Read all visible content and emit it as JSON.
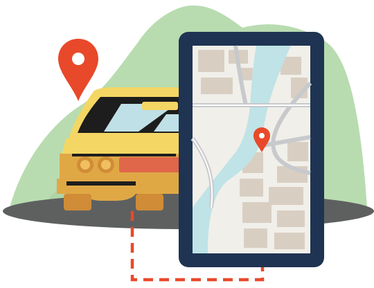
{
  "illustration": {
    "subject": "car-tracking-illustration",
    "icons": [
      "location-pin-icon",
      "car-icon",
      "tablet-icon",
      "map-icon",
      "route-line-icon"
    ],
    "colors": {
      "pin_red": "#e8492a",
      "route_red": "#e8492a",
      "car_yellow": "#f4d664",
      "car_orange": "#e0a845",
      "car_shadow_orange": "#d08c36",
      "tablet_frame": "#1f3452",
      "map_water": "#bfe3e6",
      "map_block": "#d8cfc2",
      "hill_green": "#b8dcb0",
      "ground_gray": "#5e6060",
      "windshield_dark": "#1d1d1d",
      "windshield_glass": "#bfe0e6"
    }
  }
}
